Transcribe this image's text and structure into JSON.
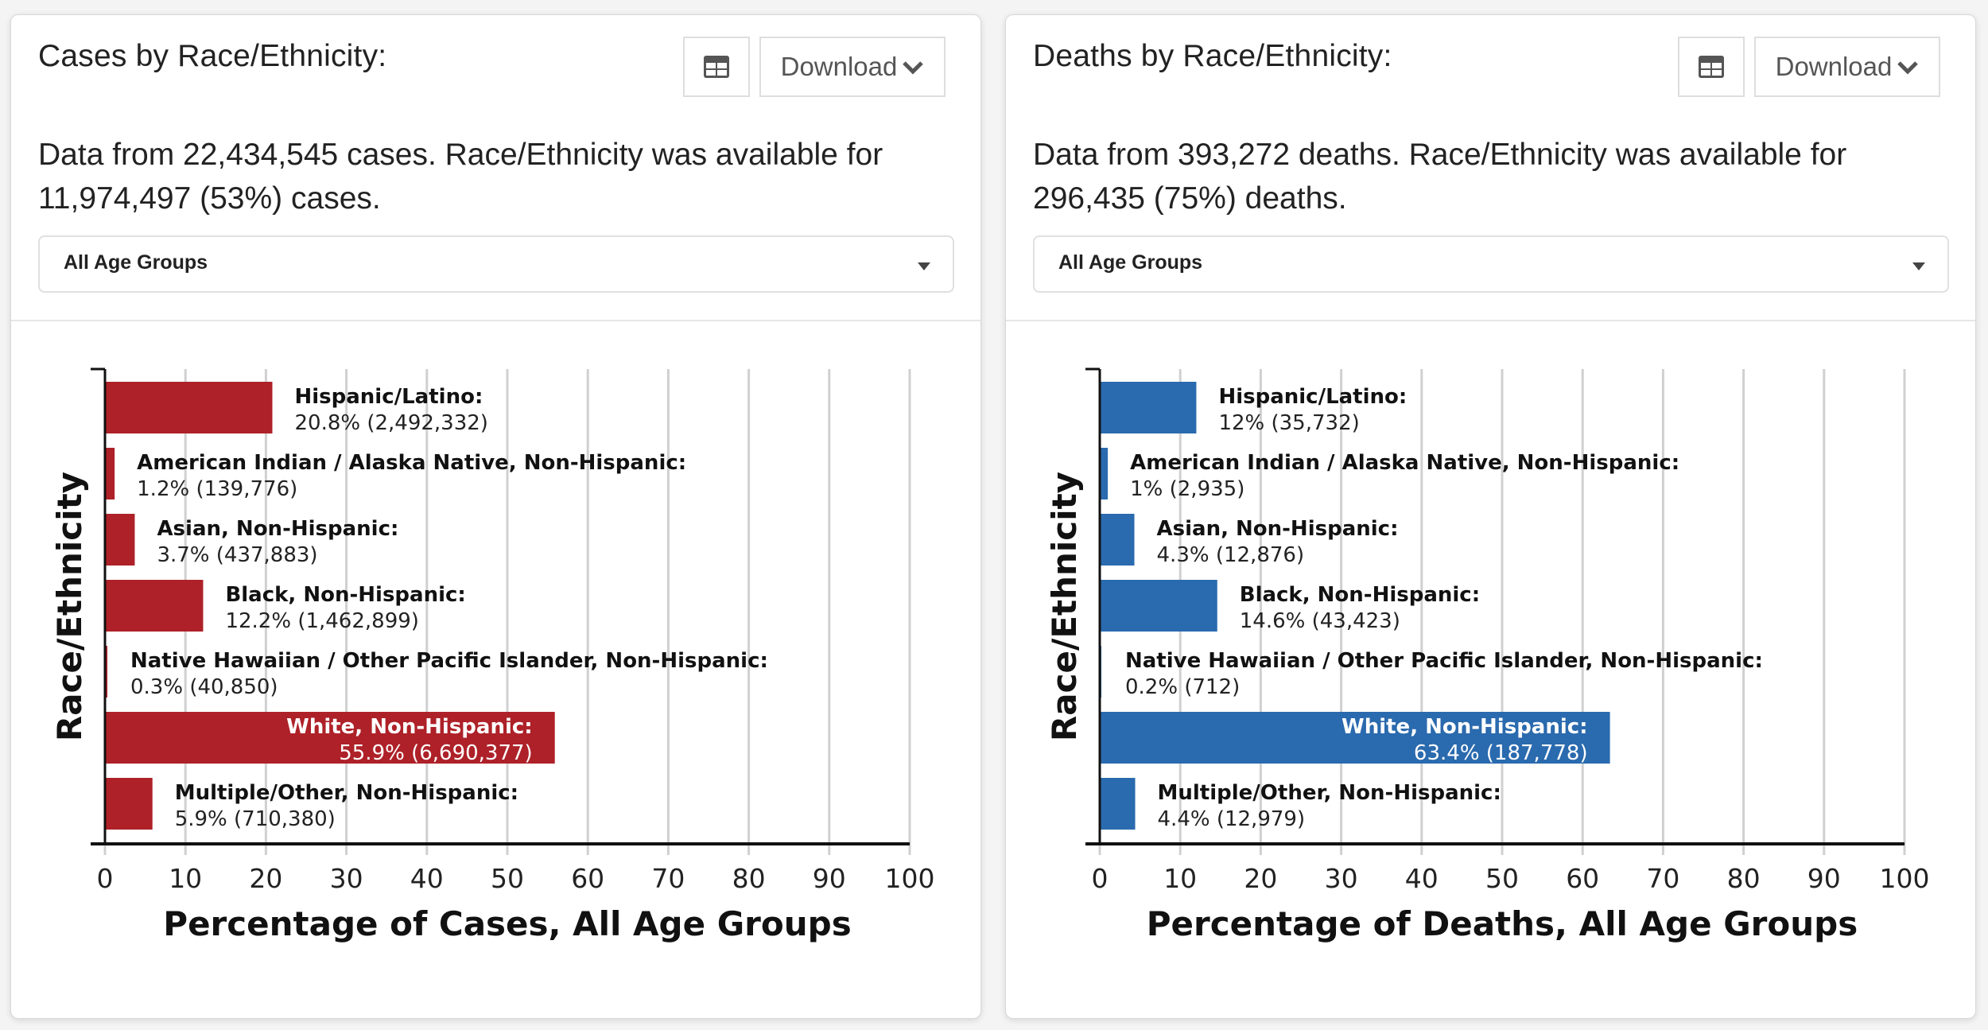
{
  "panels": [
    {
      "id": "cases",
      "title": "Cases by Race/Ethnicity:",
      "table_button_icon": "table-icon",
      "download_label": "Download",
      "download_icon": "chevron-down-icon",
      "description": "Data from 22,434,545 cases. Race/Ethnicity was available for 11,974,497 (53%) cases.",
      "age_select": {
        "selected": "All Age Groups"
      },
      "bar_color": "#ae2128"
    },
    {
      "id": "deaths",
      "title": "Deaths by Race/Ethnicity:",
      "table_button_icon": "table-icon",
      "download_label": "Download",
      "download_icon": "chevron-down-icon",
      "description": "Data from 393,272 deaths. Race/Ethnicity was available for 296,435 (75%) deaths.",
      "age_select": {
        "selected": "All Age Groups"
      },
      "bar_color": "#2a6aae"
    }
  ],
  "chart_data": [
    {
      "type": "bar",
      "orientation": "horizontal",
      "title": "Cases by Race/Ethnicity",
      "xlabel": "Percentage of Cases, All Age Groups",
      "ylabel": "Race/Ethnicity",
      "xlim": [
        0,
        100
      ],
      "xticks": [
        "0",
        "10",
        "20",
        "30",
        "40",
        "50",
        "60",
        "70",
        "80",
        "90",
        "100"
      ],
      "grid": "vertical",
      "categories": [
        "Hispanic/Latino:",
        "American Indian / Alaska Native, Non-Hispanic:",
        "Asian, Non-Hispanic:",
        "Black, Non-Hispanic:",
        "Native Hawaiian / Other Pacific Islander, Non-Hispanic:",
        "White, Non-Hispanic:",
        "Multiple/Other, Non-Hispanic:"
      ],
      "values": [
        20.8,
        1.2,
        3.7,
        12.2,
        0.3,
        55.9,
        5.9
      ],
      "value_labels": [
        "20.8% (2,492,332)",
        "1.2% (139,776)",
        "3.7% (437,883)",
        "12.2% (1,462,899)",
        "0.3% (40,850)",
        "55.9% (6,690,377)",
        "5.9% (710,380)"
      ],
      "counts": [
        2492332,
        139776,
        437883,
        1462899,
        40850,
        6690377,
        710380
      ],
      "color": "#ae2128"
    },
    {
      "type": "bar",
      "orientation": "horizontal",
      "title": "Deaths by Race/Ethnicity",
      "xlabel": "Percentage of Deaths, All Age Groups",
      "ylabel": "Race/Ethnicity",
      "xlim": [
        0,
        100
      ],
      "xticks": [
        "0",
        "10",
        "20",
        "30",
        "40",
        "50",
        "60",
        "70",
        "80",
        "90",
        "100"
      ],
      "grid": "vertical",
      "categories": [
        "Hispanic/Latino:",
        "American Indian / Alaska Native, Non-Hispanic:",
        "Asian, Non-Hispanic:",
        "Black, Non-Hispanic:",
        "Native Hawaiian / Other Pacific Islander, Non-Hispanic:",
        "White, Non-Hispanic:",
        "Multiple/Other, Non-Hispanic:"
      ],
      "values": [
        12,
        1,
        4.3,
        14.6,
        0.2,
        63.4,
        4.4
      ],
      "value_labels": [
        "12% (35,732)",
        "1% (2,935)",
        "4.3% (12,876)",
        "14.6% (43,423)",
        "0.2% (712)",
        "63.4% (187,778)",
        "4.4% (12,979)"
      ],
      "counts": [
        35732,
        2935,
        12876,
        43423,
        712,
        187778,
        12979
      ],
      "color": "#2a6aae"
    }
  ]
}
